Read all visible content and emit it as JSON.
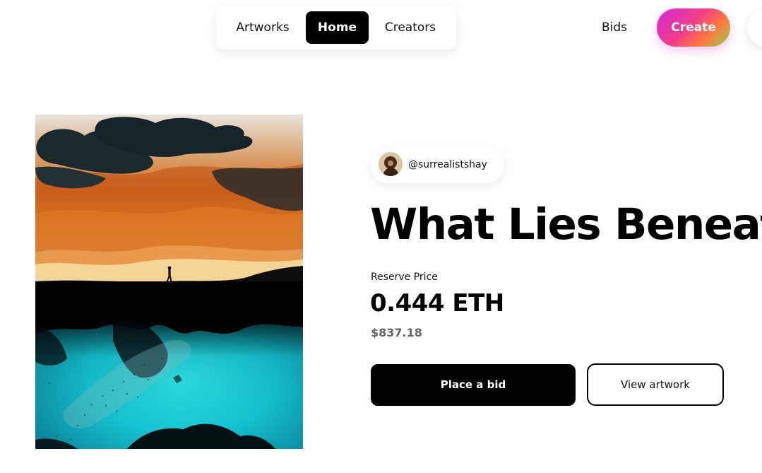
{
  "nav": {
    "links": [
      {
        "label": "Artworks"
      },
      {
        "label": "Home",
        "active": true
      },
      {
        "label": "Creators"
      }
    ],
    "bids_label": "Bids",
    "create_label": "Create"
  },
  "artwork": {
    "creator_handle": "@surrealistshay",
    "title": "What Lies Beneath",
    "reserve_label": "Reserve Price",
    "price_eth": "0.444 ETH",
    "price_usd": "$837.18",
    "place_bid_label": "Place a bid",
    "view_artwork_label": "View artwork"
  },
  "colors": {
    "primary": "#000000",
    "background": "#ffffff",
    "muted_text": "#666666",
    "create_gradient": [
      "#d22ad8",
      "#f23d8a",
      "#ff7a3d",
      "#8fd14f"
    ]
  }
}
